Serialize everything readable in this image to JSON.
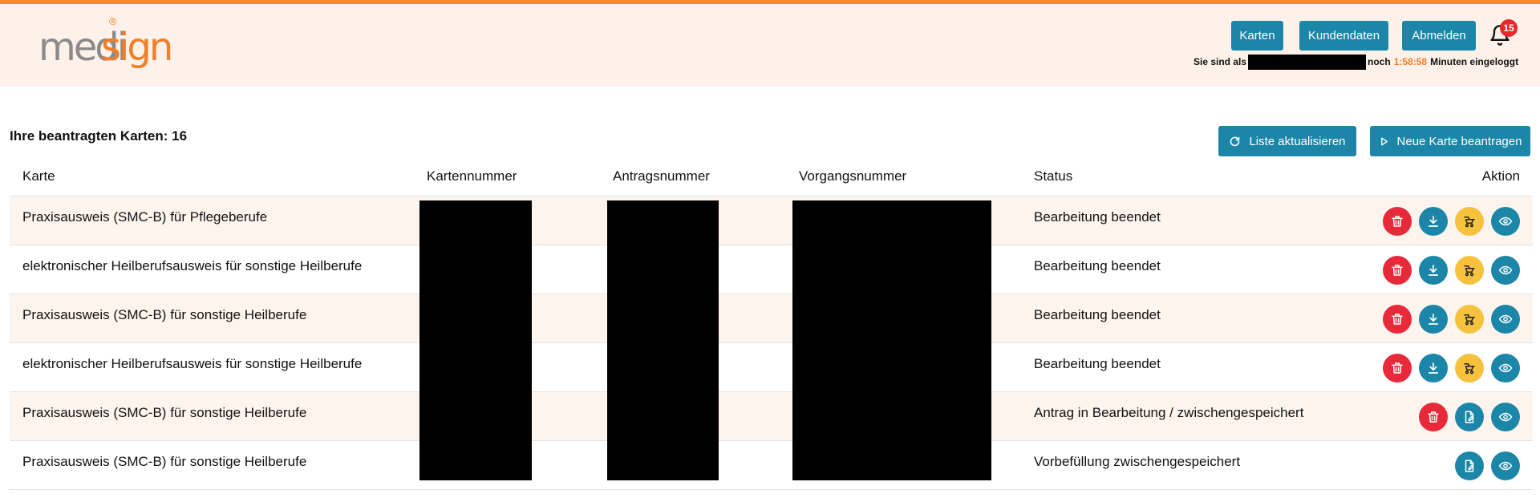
{
  "colors": {
    "accent": "#1b86a7",
    "brand_orange": "#f07f28",
    "danger": "#e8293a",
    "warning": "#f6c23e",
    "header_bg": "#fdf1e9"
  },
  "header": {
    "logo": {
      "part1": "medi",
      "part2": "sign",
      "reg": "®"
    },
    "nav": {
      "karten": "Karten",
      "kundendaten": "Kundendaten",
      "abmelden": "Abmelden"
    },
    "notifications": {
      "count": "15",
      "icon": "bell-icon"
    },
    "login_info": {
      "prefix": "Sie sind als",
      "middle": "noch",
      "timer": "1:58:58",
      "suffix": "Minuten eingeloggt"
    }
  },
  "main": {
    "count_title": "Ihre beantragten Karten: 16",
    "refresh_label": "Liste aktualisieren",
    "new_card_label": "Neue Karte beantragen",
    "columns": {
      "karte": "Karte",
      "kartennummer": "Kartennummer",
      "antragsnummer": "Antragsnummer",
      "vorgangsnummer": "Vorgangsnummer",
      "status": "Status",
      "aktion": "Aktion"
    },
    "rows": [
      {
        "karte": "Praxisausweis (SMC-B) für Pflegeberufe",
        "status": "Bearbeitung beendet",
        "actions": [
          "delete",
          "download",
          "ship",
          "view"
        ]
      },
      {
        "karte": "elektronischer Heilberufsausweis für sonstige Heilberufe",
        "status": "Bearbeitung beendet",
        "actions": [
          "delete",
          "download",
          "ship",
          "view"
        ]
      },
      {
        "karte": "Praxisausweis (SMC-B) für sonstige Heilberufe",
        "status": "Bearbeitung beendet",
        "actions": [
          "delete",
          "download",
          "ship",
          "view"
        ]
      },
      {
        "karte": "elektronischer Heilberufsausweis für sonstige Heilberufe",
        "status": "Bearbeitung beendet",
        "actions": [
          "delete",
          "download",
          "ship",
          "view"
        ]
      },
      {
        "karte": "Praxisausweis (SMC-B) für sonstige Heilberufe",
        "status": "Antrag in Bearbeitung / zwischengespeichert",
        "actions": [
          "delete",
          "edit",
          "view"
        ]
      },
      {
        "karte": "Praxisausweis (SMC-B) für sonstige Heilberufe",
        "status": "Vorbefüllung zwischengespeichert",
        "actions": [
          "edit",
          "view"
        ]
      }
    ]
  }
}
